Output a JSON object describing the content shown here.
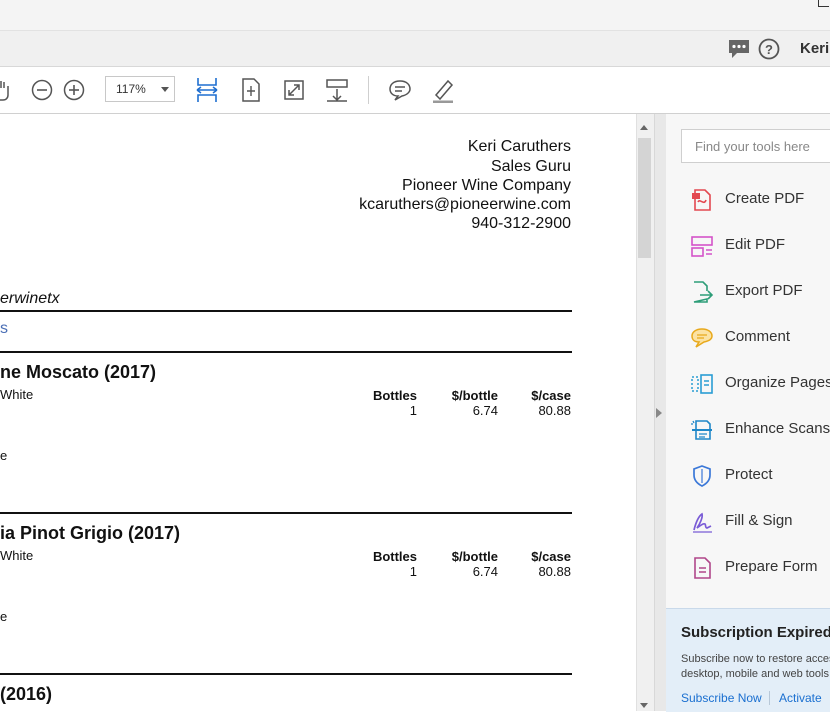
{
  "header": {
    "user_name": "Keri"
  },
  "toolbar": {
    "zoom": "117%"
  },
  "document": {
    "contact": {
      "name": "Keri Caruthers",
      "title": "Sales Guru",
      "company": "Pioneer Wine Company",
      "email": "kcaruthers@pioneerwine.com",
      "phone": "940-312-2900"
    },
    "handle_fragment": "erwinetx",
    "link_fragment": "s",
    "wines": [
      {
        "name": "ne Moscato (2017)",
        "type": "White",
        "bottles": "1",
        "per_bottle": "6.74",
        "per_case": "80.88",
        "note_fragment": "e"
      },
      {
        "name": "ia Pinot Grigio (2017)",
        "type": "White",
        "bottles": "1",
        "per_bottle": "6.74",
        "per_case": "80.88",
        "note_fragment": "e"
      },
      {
        "name": "(2016)"
      }
    ],
    "columns": {
      "bottles": "Bottles",
      "per_bottle": "$/bottle",
      "per_case": "$/case"
    }
  },
  "tools_pane": {
    "search_placeholder": "Find your tools here",
    "tools": [
      {
        "label": "Create PDF",
        "icon": "create-pdf-icon",
        "color": "#e34850"
      },
      {
        "label": "Edit PDF",
        "icon": "edit-pdf-icon",
        "color": "#d454c8"
      },
      {
        "label": "Export PDF",
        "icon": "export-pdf-icon",
        "color": "#2d9d78"
      },
      {
        "label": "Comment",
        "icon": "comment-icon",
        "color": "#e8a91c"
      },
      {
        "label": "Organize Pages",
        "icon": "organize-pages-icon",
        "color": "#2a9dd4"
      },
      {
        "label": "Enhance Scans",
        "icon": "enhance-scans-icon",
        "color": "#1e87c8"
      },
      {
        "label": "Protect",
        "icon": "protect-icon",
        "color": "#3b78d8"
      },
      {
        "label": "Fill & Sign",
        "icon": "fill-sign-icon",
        "color": "#7a5cd6"
      },
      {
        "label": "Prepare Form",
        "icon": "prepare-form-icon",
        "color": "#b0468a"
      }
    ],
    "subscription": {
      "title": "Subscription Expired",
      "line1": "Subscribe now to restore access",
      "line2": "desktop, mobile and web tools.",
      "subscribe_label": "Subscribe Now",
      "activate_label": "Activate"
    }
  }
}
